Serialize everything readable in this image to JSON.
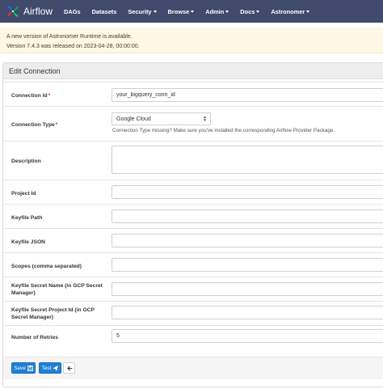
{
  "navbar": {
    "brand": "Airflow",
    "items": [
      {
        "label": "DAGs",
        "dropdown": false
      },
      {
        "label": "Datasets",
        "dropdown": false
      },
      {
        "label": "Security",
        "dropdown": true
      },
      {
        "label": "Browse",
        "dropdown": true
      },
      {
        "label": "Admin",
        "dropdown": true
      },
      {
        "label": "Docs",
        "dropdown": true
      },
      {
        "label": "Astronomer",
        "dropdown": true
      }
    ],
    "background": "#3f4a6c"
  },
  "alert": {
    "line1": "A new version of Astronomer Runtime is available.",
    "line2": "Version 7.4.3 was released on 2023-04-28, 00:00:00."
  },
  "form": {
    "title": "Edit Connection",
    "conn_id": {
      "label": "Connection Id",
      "value": "your_bigquery_conn_id"
    },
    "conn_type": {
      "label": "Connection Type",
      "value": "Google Cloud",
      "help": "Connection Type missing? Make sure you've installed the corresponding Airflow Provider Package."
    },
    "description": {
      "label": "Description",
      "value": ""
    },
    "project_id": {
      "label": "Project Id",
      "value": ""
    },
    "keyfile_path": {
      "label": "Keyfile Path",
      "value": ""
    },
    "keyfile_json": {
      "label": "Keyfile JSON",
      "value": ""
    },
    "scopes": {
      "label": "Scopes (comma separated)",
      "value": ""
    },
    "secret_name": {
      "label_line1": "Keyfile Secret Name (in GCP Secret",
      "label_line2": "Manager)",
      "value": ""
    },
    "secret_project": {
      "label_line1": "Keyfile Secret Project Id (in GCP",
      "label_line2": "Secret Manager)",
      "value": ""
    },
    "retries": {
      "label": "Number of Retries",
      "value": "5"
    },
    "required_marker": "*"
  },
  "buttons": {
    "save": "Save",
    "test": "Test"
  },
  "icons": {
    "save": "floppy-disk-icon",
    "test": "paper-plane-icon",
    "back": "arrow-left-icon"
  },
  "colors": {
    "primary": "#1f7fd6",
    "alert_bg": "#fcf8e3",
    "required": "#c0392b"
  }
}
